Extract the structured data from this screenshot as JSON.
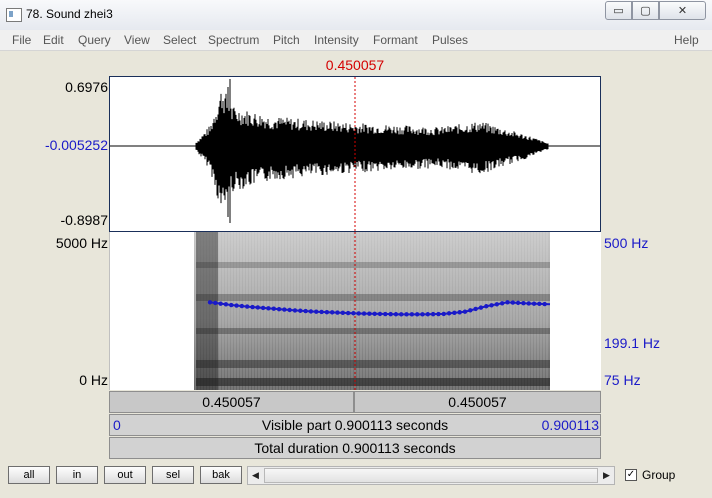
{
  "window": {
    "title": "78. Sound zhei3",
    "minimize_glyph": "▭",
    "maximize_glyph": "▢",
    "close_glyph": "✕"
  },
  "menu": {
    "items": [
      "File",
      "Edit",
      "Query",
      "View",
      "Select",
      "Spectrum",
      "Pitch",
      "Intensity",
      "Formant",
      "Pulses"
    ],
    "help": "Help"
  },
  "cursor": {
    "time_label": "0.450057",
    "time_fraction": 0.5
  },
  "waveform": {
    "y_max_label": "0.6976",
    "y_mid_label": "-0.005252",
    "y_min_label": "-0.8987"
  },
  "spectrogram": {
    "freq_top_label": "5000 Hz",
    "freq_bottom_label": "0 Hz",
    "pitch_top_label": "500 Hz",
    "pitch_value_label": "199.1 Hz",
    "pitch_bottom_label": "75 Hz",
    "pitch_contour_hz": [
      215,
      208,
      203,
      199,
      195,
      192,
      190,
      188,
      187,
      186,
      186,
      187,
      192,
      205,
      215,
      212,
      210
    ]
  },
  "selection": {
    "left_time": "0.450057",
    "right_time": "0.450057"
  },
  "visible_bar": {
    "start": "0",
    "text": "Visible part 0.900113 seconds",
    "end": "0.900113"
  },
  "total_bar": {
    "text": "Total duration 0.900113 seconds"
  },
  "buttons": {
    "all": "all",
    "in": "in",
    "out": "out",
    "sel": "sel",
    "bak": "bak"
  },
  "scroll": {
    "left_glyph": "◀",
    "right_glyph": "▶"
  },
  "group": {
    "label": "Group",
    "checked": true,
    "check_glyph": "✓"
  },
  "colors": {
    "cursor": "#d40000",
    "pitch": "#1a1ac8",
    "label_blue": "#1a1ac8"
  }
}
